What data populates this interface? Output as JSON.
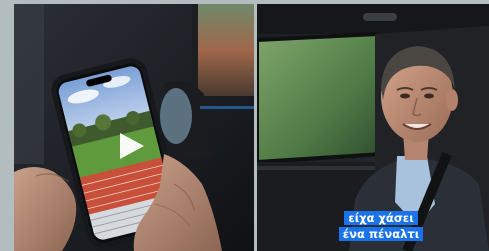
{
  "caption": {
    "line1": "είχα χάσει",
    "line2": "ένα πέναλτι"
  },
  "video_icon": "play-icon",
  "colors": {
    "caption_bg": "#1a73e8",
    "caption_text": "#ffffff",
    "running_track": "#c8503a",
    "field_grass": "#5f9a3c"
  }
}
